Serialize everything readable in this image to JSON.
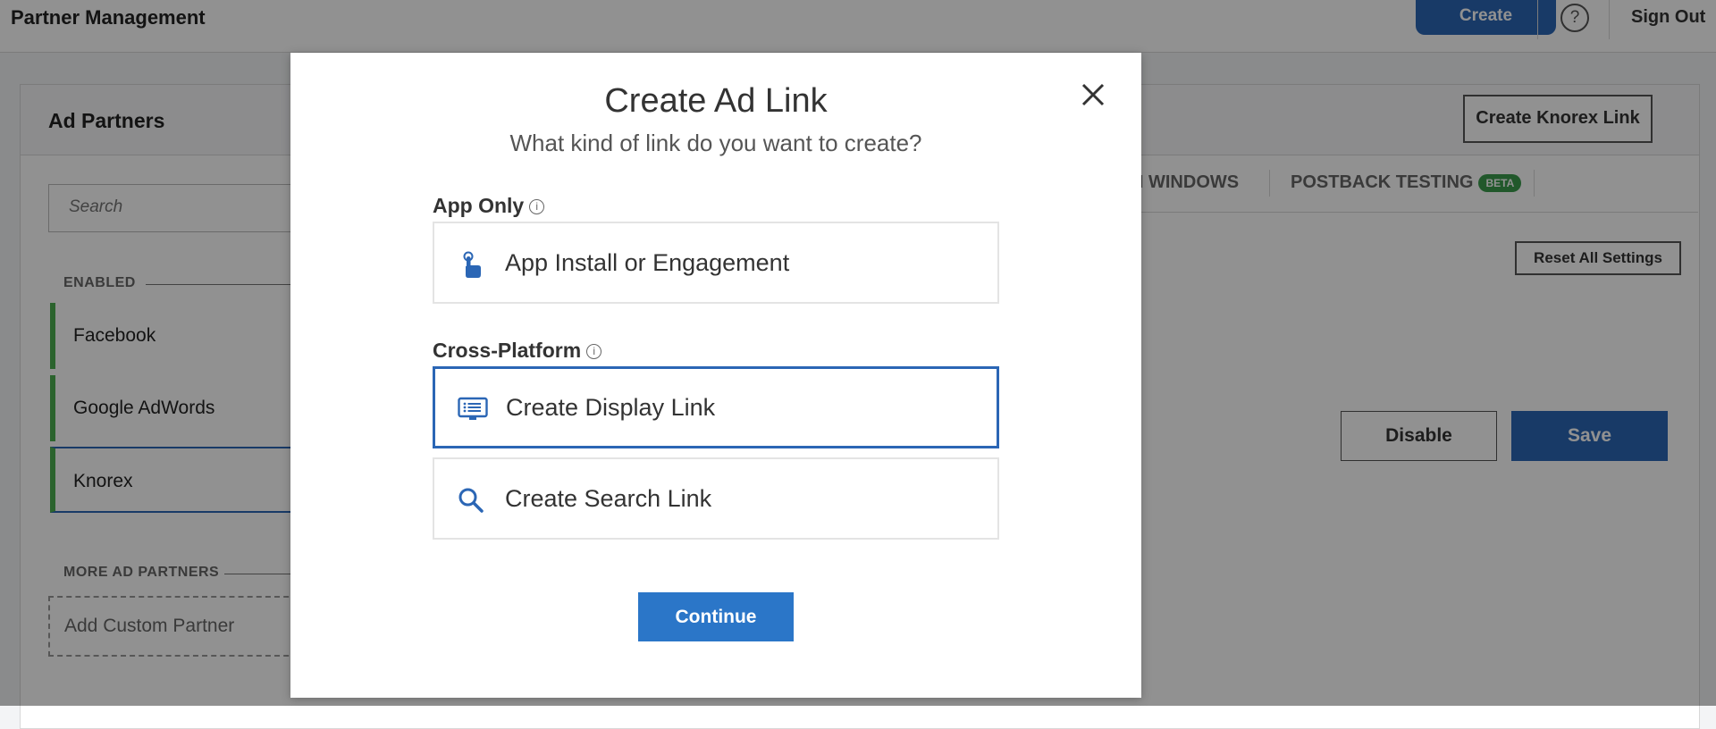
{
  "topbar": {
    "title": "Partner Management",
    "create_label": "Create",
    "help_glyph": "?",
    "sign_out_label": "Sign Out"
  },
  "panel": {
    "title": "Ad Partners",
    "create_knorex_label": "Create Knorex Link",
    "search_placeholder": "Search",
    "enabled_label": "ENABLED",
    "partners": [
      {
        "label": "Facebook"
      },
      {
        "label": "Google AdWords"
      },
      {
        "label": "Knorex"
      }
    ],
    "more_label": "MORE AD PARTNERS",
    "add_custom_label": "Add Custom Partner"
  },
  "tabs": [
    {
      "label": "N WINDOWS"
    },
    {
      "label": "POSTBACK TESTING",
      "badge": "BETA"
    }
  ],
  "settings": {
    "reset_label": "Reset All Settings",
    "disable_label": "Disable",
    "save_label": "Save"
  },
  "modal": {
    "title": "Create Ad Link",
    "subtitle": "What kind of link do you want to create?",
    "groups": [
      {
        "label": "App Only",
        "options": [
          {
            "label": "App Install or Engagement",
            "icon": "tap-hand-icon"
          }
        ]
      },
      {
        "label": "Cross-Platform",
        "options": [
          {
            "label": "Create Display Link",
            "icon": "display-icon",
            "selected": true
          },
          {
            "label": "Create Search Link",
            "icon": "search-icon"
          }
        ]
      }
    ],
    "continue_label": "Continue"
  },
  "colors": {
    "accent": "#2b66b5",
    "continue": "#2b76c8",
    "enabled_bar": "#4caf50",
    "beta_badge": "#3a9c4d"
  }
}
